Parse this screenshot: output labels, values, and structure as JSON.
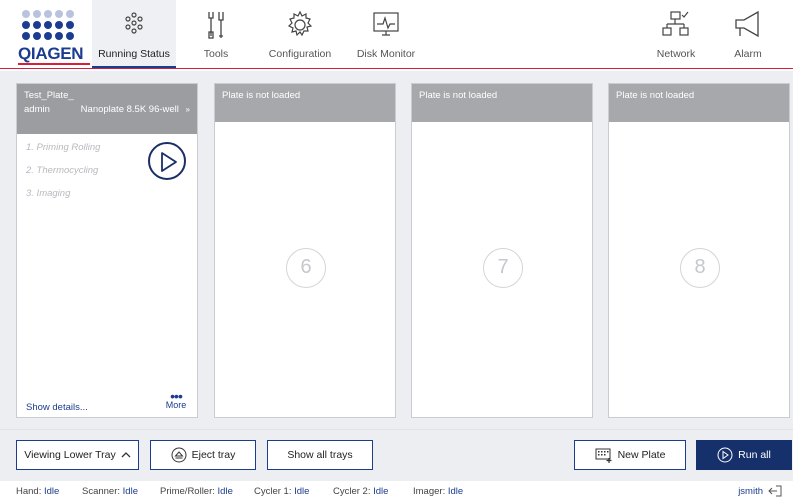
{
  "brand": {
    "name": "QIAGEN",
    "dot_colors": [
      "#b9c3dd",
      "#1b3c8f"
    ]
  },
  "nav": {
    "items": [
      {
        "label": "Running Status",
        "icon": "running-status-icon",
        "active": true
      },
      {
        "label": "Tools",
        "icon": "tools-icon"
      },
      {
        "label": "Configuration",
        "icon": "configuration-icon"
      },
      {
        "label": "Disk Monitor",
        "icon": "disk-monitor-icon"
      },
      {
        "label": "Network",
        "icon": "network-icon"
      },
      {
        "label": "Alarm",
        "icon": "alarm-icon"
      }
    ]
  },
  "plates": [
    {
      "title": "Test_Plate_",
      "user": "admin",
      "plate_type": "Nanoplate 8.5K 96-well",
      "dots": "»",
      "steps": [
        "1. Priming Rolling",
        "2. Thermocycling",
        "3. Imaging"
      ],
      "show_details": "Show details...",
      "more": "More"
    },
    {
      "status": "Plate is not loaded",
      "number": "6"
    },
    {
      "status": "Plate is not loaded",
      "number": "7"
    },
    {
      "status": "Plate is not loaded",
      "number": "8"
    }
  ],
  "actions": {
    "viewing_tray": "Viewing Lower Tray",
    "eject_tray": "Eject tray",
    "show_all_trays": "Show all trays",
    "new_plate": "New Plate",
    "run_all": "Run all"
  },
  "status": {
    "items": [
      {
        "label": "Hand:",
        "value": "Idle"
      },
      {
        "label": "Scanner:",
        "value": "Idle"
      },
      {
        "label": "Prime/Roller:",
        "value": "Idle"
      },
      {
        "label": "Cycler 1:",
        "value": "Idle"
      },
      {
        "label": "Cycler 2:",
        "value": "Idle"
      },
      {
        "label": "Imager:",
        "value": "Idle"
      }
    ],
    "user": "jsmith"
  },
  "colors": {
    "accent": "#1b3c8f",
    "brand_red": "#d81e3a",
    "primary_button": "#15306b"
  }
}
